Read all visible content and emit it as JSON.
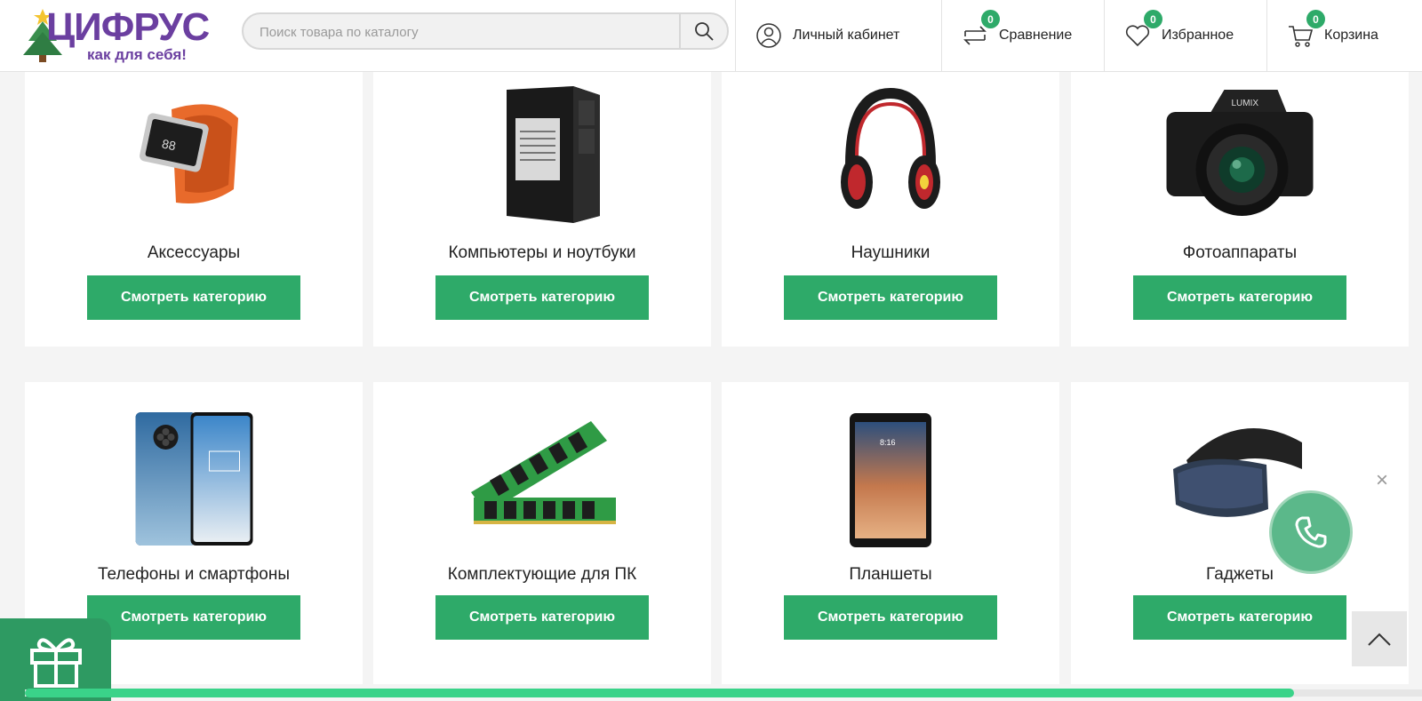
{
  "logo": {
    "word": "ЦИФРУС",
    "tagline": "как для себя!"
  },
  "search": {
    "placeholder": "Поиск товара по каталогу"
  },
  "header_nav": {
    "account": {
      "label": "Личный кабинет",
      "icon": "user-icon"
    },
    "compare": {
      "label": "Сравнение",
      "count": "0",
      "icon": "compare-arrows-icon"
    },
    "favorites": {
      "label": "Избранное",
      "count": "0",
      "icon": "heart-icon"
    },
    "cart": {
      "label": "Корзина",
      "count": "0",
      "icon": "cart-icon"
    }
  },
  "categories": [
    {
      "title": "Аксессуары",
      "button": "Смотреть категорию",
      "image": "smartwatch-image"
    },
    {
      "title": "Компьютеры и ноутбуки",
      "button": "Смотреть категорию",
      "image": "pc-tower-image"
    },
    {
      "title": "Наушники",
      "button": "Смотреть категорию",
      "image": "headphones-image"
    },
    {
      "title": "Фотоаппараты",
      "button": "Смотреть категорию",
      "image": "camera-image"
    },
    {
      "title": "Телефоны и смартфоны",
      "button": "Смотреть категорию",
      "image": "smartphone-image"
    },
    {
      "title": "Комплектующие для ПК",
      "button": "Смотреть категорию",
      "image": "ram-modules-image"
    },
    {
      "title": "Планшеты",
      "button": "Смотреть категорию",
      "image": "tablet-image"
    },
    {
      "title": "Гаджеты",
      "button": "Смотреть категорию",
      "image": "vr-headset-image"
    }
  ],
  "widgets": {
    "close": "×",
    "scroll_progress": 0.91
  },
  "colors": {
    "accent": "#2eaa69",
    "brand": "#6b3fa0"
  }
}
